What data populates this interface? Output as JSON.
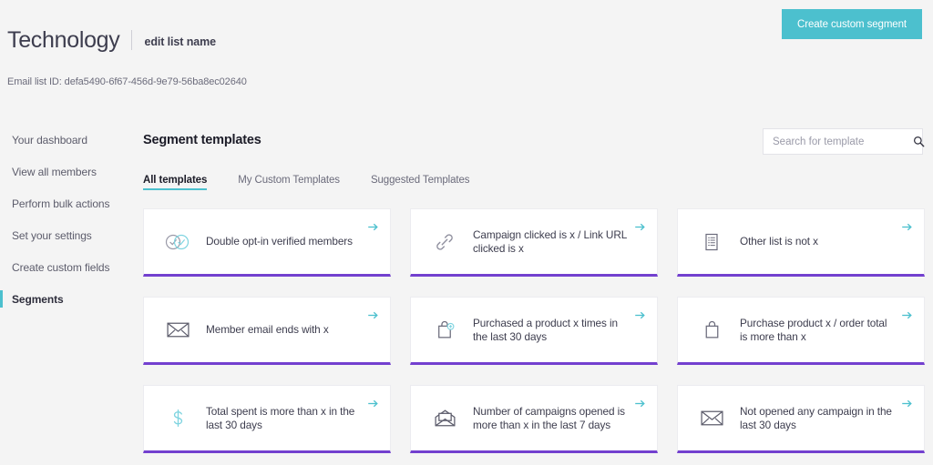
{
  "header": {
    "list_title": "Technology",
    "edit_link": "edit list name",
    "list_id_label": "Email list ID: defa5490-6f67-456d-9e79-56ba8ec02640",
    "create_segment_button": "Create custom segment"
  },
  "colors": {
    "accent_teal": "#4cc0ce",
    "card_underline_purple": "#7340cf",
    "page_background": "#f4f4f4",
    "card_background": "#ffffff",
    "text_primary": "#3d3d4e"
  },
  "sidebar": {
    "items": [
      {
        "label": "Your dashboard",
        "active": false
      },
      {
        "label": "View all members",
        "active": false
      },
      {
        "label": "Perform bulk actions",
        "active": false
      },
      {
        "label": "Set your settings",
        "active": false
      },
      {
        "label": "Create custom fields",
        "active": false
      },
      {
        "label": "Segments",
        "active": true
      }
    ]
  },
  "main": {
    "section_title": "Segment templates",
    "search": {
      "placeholder": "Search for template",
      "value": ""
    },
    "tabs": [
      {
        "label": "All templates",
        "active": true
      },
      {
        "label": "My Custom Templates",
        "active": false
      },
      {
        "label": "Suggested Templates",
        "active": false
      }
    ],
    "cards": [
      {
        "label": "Double opt-in verified members",
        "icon": "double-check-circles-icon"
      },
      {
        "label": "Campaign clicked is x / Link URL clicked is x",
        "icon": "link-icon"
      },
      {
        "label": "Other list is not x",
        "icon": "list-document-icon"
      },
      {
        "label": "Member email ends with x",
        "icon": "envelope-icon"
      },
      {
        "label": "Purchased a product x times in the last 30 days",
        "icon": "shopping-bag-plus-icon"
      },
      {
        "label": "Purchase product x / order total is more than x",
        "icon": "shopping-bag-icon"
      },
      {
        "label": "Total spent is more than x in the last 30 days",
        "icon": "dollar-sign-icon"
      },
      {
        "label": "Number of campaigns opened is more than x in the last 7 days",
        "icon": "open-envelope-icon"
      },
      {
        "label": "Not opened any campaign in the last 30 days",
        "icon": "envelope-icon"
      }
    ],
    "card_arrow_icon": "arrow-right-icon"
  }
}
